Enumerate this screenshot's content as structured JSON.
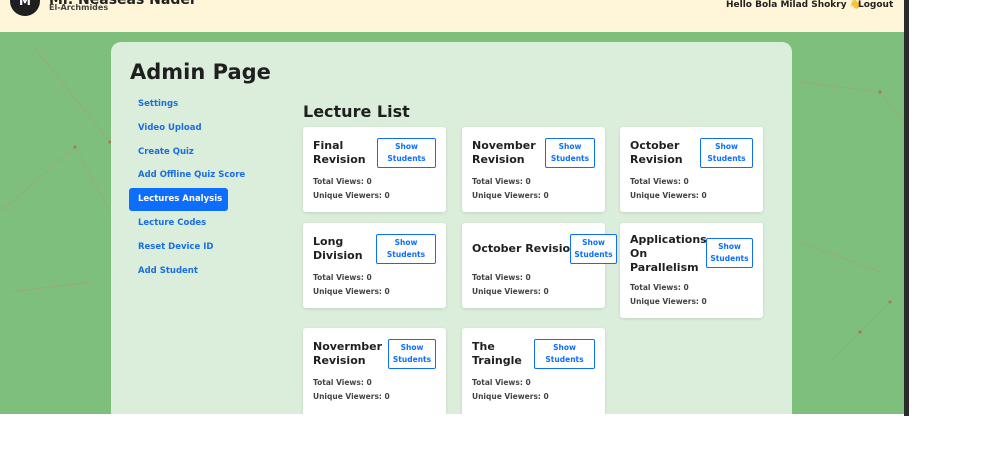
{
  "header": {
    "logo_text": "M",
    "brand_name": "Mr. Neaseas Nader",
    "brand_sub": "El-Archmides",
    "greeting": "Hello Bola Milad Shokry 👋",
    "logout": "Logout"
  },
  "admin": {
    "title": "Admin Page",
    "sidebar": [
      {
        "label": "Settings"
      },
      {
        "label": "Video Upload"
      },
      {
        "label": "Create Quiz"
      },
      {
        "label": "Add Offline Quiz Score"
      },
      {
        "label": "Lectures Analysis",
        "active": true
      },
      {
        "label": "Lecture Codes"
      },
      {
        "label": "Reset Device ID"
      },
      {
        "label": "Add Student"
      }
    ],
    "list_title": "Lecture List",
    "show_label_1": "Show",
    "show_label_2": "Students",
    "views_prefix": "Total Views:",
    "viewers_prefix": "Unique Viewers:",
    "lectures": [
      {
        "title_1": "Final",
        "title_2": "Revision",
        "total_views": "0",
        "unique_viewers": "0"
      },
      {
        "title_1": "November",
        "title_2": "Revision",
        "total_views": "0",
        "unique_viewers": "0"
      },
      {
        "title_1": "October",
        "title_2": "Revision",
        "total_views": "0",
        "unique_viewers": "0"
      },
      {
        "title_1": "Long",
        "title_2": "Division",
        "total_views": "0",
        "unique_viewers": "0"
      },
      {
        "title_1": "October Revision",
        "title_2": "",
        "total_views": "0",
        "unique_viewers": "0"
      },
      {
        "title_1": "Applications",
        "title_2": "On",
        "title_3": "Parallelism",
        "total_views": "0",
        "unique_viewers": "0"
      },
      {
        "title_1": "Novermber",
        "title_2": "Revision",
        "total_views": "0",
        "unique_viewers": "0"
      },
      {
        "title_1": "The",
        "title_2": "Traingle",
        "total_views": "0",
        "unique_viewers": "0"
      }
    ]
  },
  "colors": {
    "background": "#7dbf7b",
    "panel": "#dbeedb",
    "accent": "#0d6efd",
    "topbar": "#fff6d9"
  }
}
